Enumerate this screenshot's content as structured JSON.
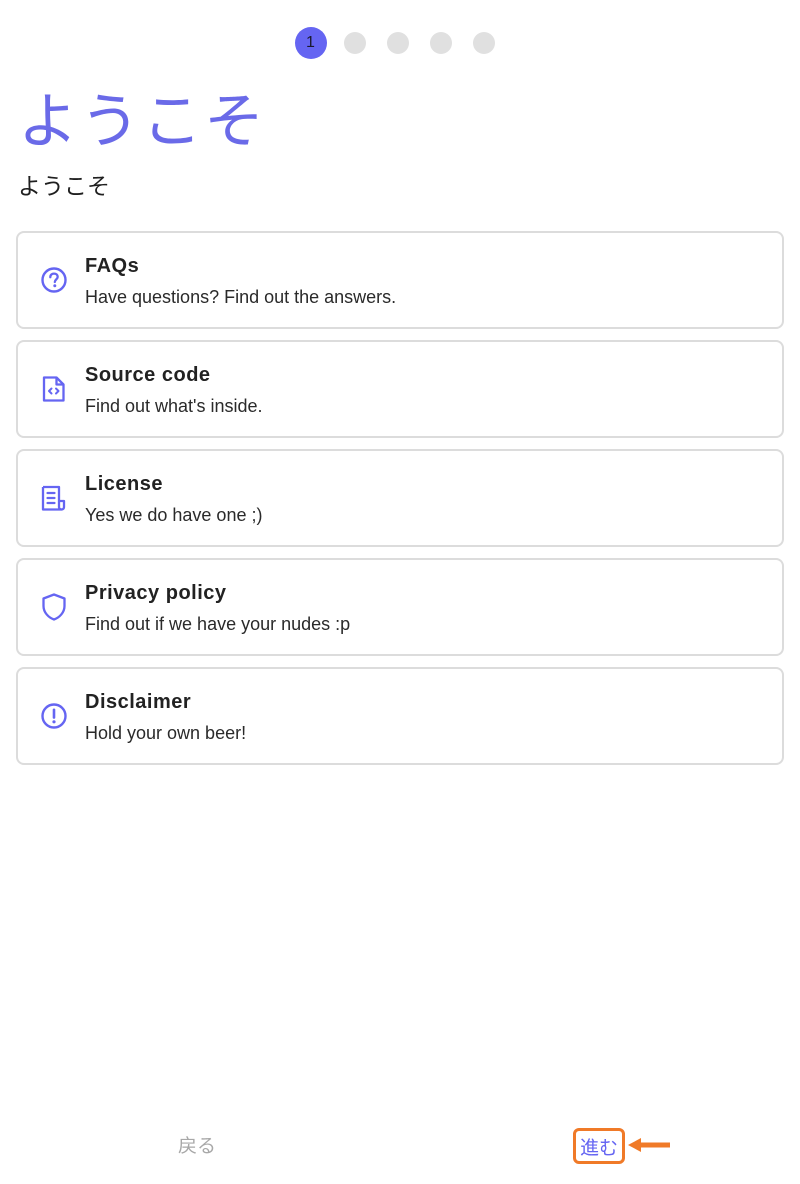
{
  "stepper": {
    "steps": [
      "1",
      "",
      "",
      "",
      ""
    ],
    "active_index": 0,
    "active_color": "#6565f2",
    "inactive_color": "#e0e0e0"
  },
  "header": {
    "title": "ようこそ",
    "subtitle": "ようこそ"
  },
  "cards": [
    {
      "icon": "question-circle-icon",
      "title": "FAQs",
      "description": "Have questions? Find out the answers."
    },
    {
      "icon": "code-file-icon",
      "title": "Source code",
      "description": "Find out what's inside."
    },
    {
      "icon": "document-icon",
      "title": "License",
      "description": "Yes we do have one ;)"
    },
    {
      "icon": "shield-icon",
      "title": "Privacy policy",
      "description": "Find out if we have your nudes :p"
    },
    {
      "icon": "exclamation-circle-icon",
      "title": "Disclaimer",
      "description": "Hold your own beer!"
    }
  ],
  "footer": {
    "back_label": "戻る",
    "next_label": "進む"
  },
  "colors": {
    "accent": "#6565f2",
    "highlight": "#f07a28",
    "card_border": "#dcdcdc"
  }
}
